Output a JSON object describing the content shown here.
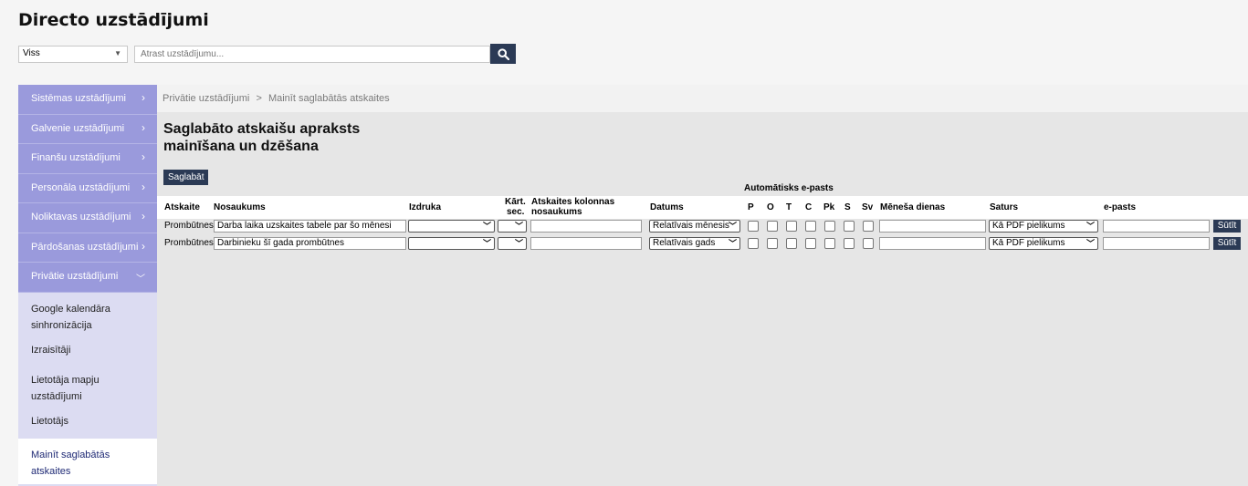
{
  "app": {
    "title": "Directo uzstādījumi"
  },
  "search": {
    "category": "Viss",
    "placeholder": "Atrast uzstādījumu..."
  },
  "sidebar": {
    "items": [
      {
        "label": "Sistēmas uzstādījumi"
      },
      {
        "label": "Galvenie uzstādījumi"
      },
      {
        "label": "Finanšu uzstādījumi"
      },
      {
        "label": "Personāla uzstādījumi"
      },
      {
        "label": "Noliktavas uzstādījumi"
      },
      {
        "label": "Pārdošanas uzstādījumi"
      },
      {
        "label": "Privātie uzstādījumi"
      }
    ],
    "subitems": [
      {
        "label_1": "Google kalendāra",
        "label_2": "sinhronizācija"
      },
      {
        "label_1": "Izraisītāji"
      },
      {
        "label_1": "Lietotāja mapju",
        "label_2": "uzstādījumi"
      },
      {
        "label_1": "Lietotājs"
      },
      {
        "label_1": "Mainīt saglabātās",
        "label_2": "atskaites"
      }
    ]
  },
  "breadcrumb": {
    "parent": "Privātie uzstādījumi",
    "separator": ">",
    "current": "Mainīt saglabātās atskaites"
  },
  "page": {
    "title_1": "Saglabāto atskaišu apraksts",
    "title_2": "mainīšana un dzēšana",
    "save_label": "Saglabāt"
  },
  "table": {
    "email_group": "Automātisks e-pasts",
    "headers": {
      "report": "Atskaite",
      "name": "Nosaukums",
      "print": "Izdruka",
      "sort_1": "Kārt.",
      "sort_2": "sec.",
      "col_1": "Atskaites kolonnas",
      "col_2": "nosaukums",
      "date": "Datums",
      "p": "P",
      "o": "O",
      "t": "T",
      "c": "C",
      "pk": "Pk",
      "s": "S",
      "sv": "Sv",
      "month_days": "Mēneša dienas",
      "content": "Saturs",
      "email": "e-pasts"
    },
    "rows": [
      {
        "report": "Prombūtnes",
        "name": "Darba laika uzskaites tabele par šo mēnesi",
        "date": "Relatīvais mēnesis",
        "content": "Kā PDF pielikums",
        "send_label": "Sūtīt"
      },
      {
        "report": "Prombūtnes",
        "name": "Darbinieku šī gada prombūtnes",
        "date": "Relatīvais gads",
        "content": "Kā PDF pielikums",
        "send_label": "Sūtīt"
      }
    ]
  }
}
